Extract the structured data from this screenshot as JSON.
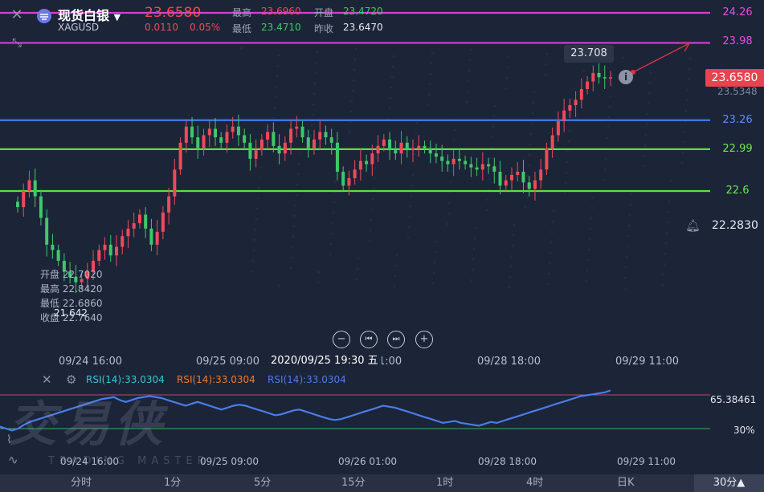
{
  "header": {
    "title": "现货白银",
    "symbol": "XAGUSD",
    "price": "23.6580",
    "change": "0.0110",
    "change_pct": "0.05%",
    "high_label": "最高",
    "high_value": "23.6960",
    "open_label": "开盘",
    "open_value": "23.4720",
    "low_label": "最低",
    "low_value": "23.4710",
    "prev_close_label": "昨收",
    "prev_close_value": "23.6470"
  },
  "levels": [
    {
      "label": "24.26",
      "value": 24.26,
      "color": "#d63fd6"
    },
    {
      "label": "23.98",
      "value": 23.98,
      "color": "#d63fd6"
    },
    {
      "label": "23.26",
      "value": 23.26,
      "color": "#3f7ef0"
    },
    {
      "label": "22.99",
      "value": 22.99,
      "color": "#5fe03a"
    },
    {
      "label": "22.6",
      "value": 22.6,
      "color": "#5fe03a"
    }
  ],
  "price_tag": "23.6580",
  "price_tag_sub": "23.5348",
  "tooltip_high": "23.708",
  "alert_price": "22.2830",
  "ohlc_panel": {
    "open_label": "开盘",
    "open_value": "22.7020",
    "high_label": "最高",
    "high_value": "22.8420",
    "low_label": "最低",
    "low_value": "22.6860",
    "close_label": "收盘",
    "close_value": "22.7640"
  },
  "low_marker": "21.642",
  "time_axis": [
    "09/24 16:00",
    "09/25 09:00",
    "09/28 18:00",
    "09/29 11:00"
  ],
  "time_axis_partial": "1:00",
  "crosshair_time": "2020/09/25 19:30 五",
  "controls": {
    "zoom_out": "−",
    "prev": "⏮",
    "next": "⏭",
    "zoom_in": "+"
  },
  "rsi": {
    "labels": [
      "RSI(14):33.0304",
      "RSI(14):33.0304",
      "RSI(14):33.0304"
    ],
    "label_colors": [
      "#38c7d6",
      "#f07b2c",
      "#4a7de8"
    ],
    "upper_value": "65.38461",
    "lower_value": "30%",
    "time_axis": [
      "09/24 16:00",
      "09/25 09:00",
      "09/26 01:00",
      "09/28 18:00",
      "09/29 11:00"
    ]
  },
  "watermark": "交易侠",
  "watermark_sub": "TRADING MASTER",
  "bottom_bar": {
    "tabs": [
      "分时",
      "1分",
      "5分",
      "15分",
      "1时",
      "4时",
      "日K"
    ],
    "period": "30分▲"
  },
  "chart_data": {
    "type": "candlestick",
    "title": "现货白银 XAGUSD",
    "x_labels": [
      "09/24 16:00",
      "09/25 09:00",
      "09/25 19:30",
      "09/28 18:00",
      "09/29 11:00"
    ],
    "ylim": [
      21.55,
      24.3
    ],
    "closes": [
      22.45,
      22.6,
      22.7,
      22.55,
      22.35,
      22.1,
      22.05,
      21.95,
      21.85,
      21.8,
      21.75,
      21.78,
      21.85,
      21.95,
      22.05,
      22.1,
      22.0,
      22.08,
      22.18,
      22.25,
      22.3,
      22.38,
      22.25,
      22.1,
      22.22,
      22.4,
      22.55,
      22.8,
      23.05,
      23.2,
      23.1,
      23.0,
      23.12,
      23.18,
      23.1,
      23.05,
      23.15,
      23.2,
      23.12,
      23.05,
      22.9,
      22.98,
      23.08,
      23.15,
      23.02,
      22.95,
      23.05,
      23.18,
      23.2,
      23.1,
      23.0,
      23.08,
      23.15,
      23.1,
      23.05,
      22.78,
      22.65,
      22.72,
      22.8,
      22.88,
      22.85,
      22.95,
      23.02,
      23.08,
      22.98,
      22.95,
      23.05,
      22.98,
      23.0,
      23.02,
      23.0,
      22.95,
      22.92,
      22.88,
      22.85,
      22.9,
      22.88,
      22.85,
      22.82,
      22.8,
      22.85,
      22.83,
      22.78,
      22.65,
      22.7,
      22.75,
      22.78,
      22.68,
      22.62,
      22.7,
      22.8,
      23.0,
      23.12,
      23.25,
      23.35,
      23.4,
      23.45,
      23.55,
      23.62,
      23.7,
      23.66,
      23.65,
      23.66
    ],
    "rsi": [
      32,
      30,
      28,
      30,
      34,
      37,
      39,
      41,
      43,
      45,
      47,
      49,
      51,
      53,
      55,
      57,
      59,
      61,
      62,
      63,
      60,
      58,
      60,
      62,
      63,
      64,
      63,
      62,
      60,
      58,
      56,
      54,
      56,
      58,
      56,
      54,
      52,
      50,
      52,
      54,
      55,
      54,
      52,
      50,
      48,
      46,
      44,
      45,
      47,
      49,
      50,
      48,
      46,
      44,
      42,
      40,
      39,
      40,
      42,
      44,
      46,
      48,
      50,
      52,
      54,
      53,
      52,
      50,
      48,
      46,
      44,
      42,
      40,
      38,
      36,
      37,
      38,
      36,
      35,
      34,
      33,
      35,
      37,
      36,
      38,
      40,
      42,
      44,
      46,
      48,
      50,
      52,
      54,
      56,
      58,
      60,
      62,
      64,
      65,
      66,
      67,
      68,
      70
    ]
  }
}
